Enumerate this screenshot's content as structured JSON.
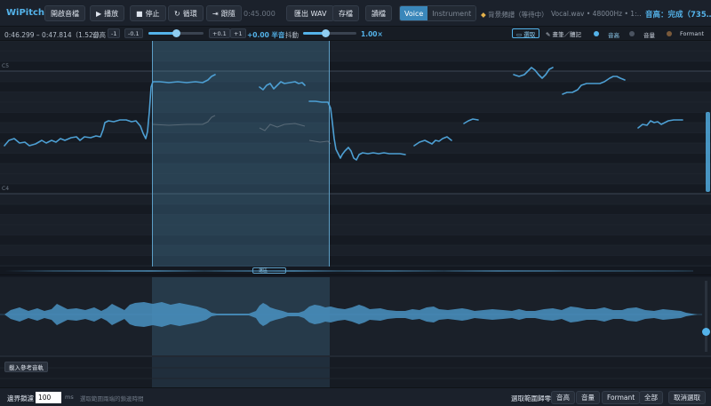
{
  "toolbar": {
    "app_title": "WiPitch",
    "open_label": "開啟音檔",
    "play_label": "播放",
    "stop_label": "停止",
    "loop_label": "循環",
    "follow_label": "跟隨",
    "timecode": "0:45.000",
    "export_label": "匯出 WAV",
    "save_label": "存檔",
    "load_label": "讀檔",
    "mode_voice": "Voice",
    "mode_instrument": "Instrument",
    "analysis_status": "背景頻譜（等待中）",
    "file_info": "Vocal.wav  •  48000Hz  •  1:…",
    "pitch_status": "音高：完成（735…"
  },
  "icons": {
    "play": "play-icon",
    "stop": "stop-icon",
    "loop": "loop-icon",
    "follow": "follow-icon",
    "status": "diamond-icon"
  },
  "controls": {
    "selection_range": "0:46.299 – 0:47.814（1.52s）",
    "pitch_label": "音高",
    "pitch_minus1": "-1",
    "pitch_minus01": "-0.1",
    "pitch_plus01": "+0.1",
    "pitch_plus1": "+1",
    "pitch_value": "+0.00 半音",
    "pitch_slider": 0.5,
    "jitter_label": "抖動",
    "jitter_value": "1.00×",
    "jitter_slider": 0.42,
    "select_mode": "▭ 選取",
    "draw_mode": "✎ 畫筆／體記",
    "layer_pitch": "音高",
    "layer_volume": "音量",
    "layer_formant": "Formant"
  },
  "pitch_editor": {
    "note_c5": "C5",
    "note_c4": "C4"
  },
  "overview": {
    "label": "選區"
  },
  "reference": {
    "load_label": "載入參考音軌"
  },
  "bottom": {
    "threshold_label": "邊界鎖濾",
    "threshold_value": "100",
    "threshold_unit": "ms",
    "threshold_hint": "選取範圍兩端的鎖邊時間",
    "select_zero_label": "選取範圍歸零",
    "btn_pitch": "音高",
    "btn_volume": "音量",
    "btn_formant": "Formant",
    "btn_all": "全部",
    "btn_cancel": "取消選取"
  },
  "colors": {
    "accent": "#54b3ea",
    "background": "#181e27",
    "selection": "#5c9ec6",
    "status_dot": "#e4b14a"
  }
}
